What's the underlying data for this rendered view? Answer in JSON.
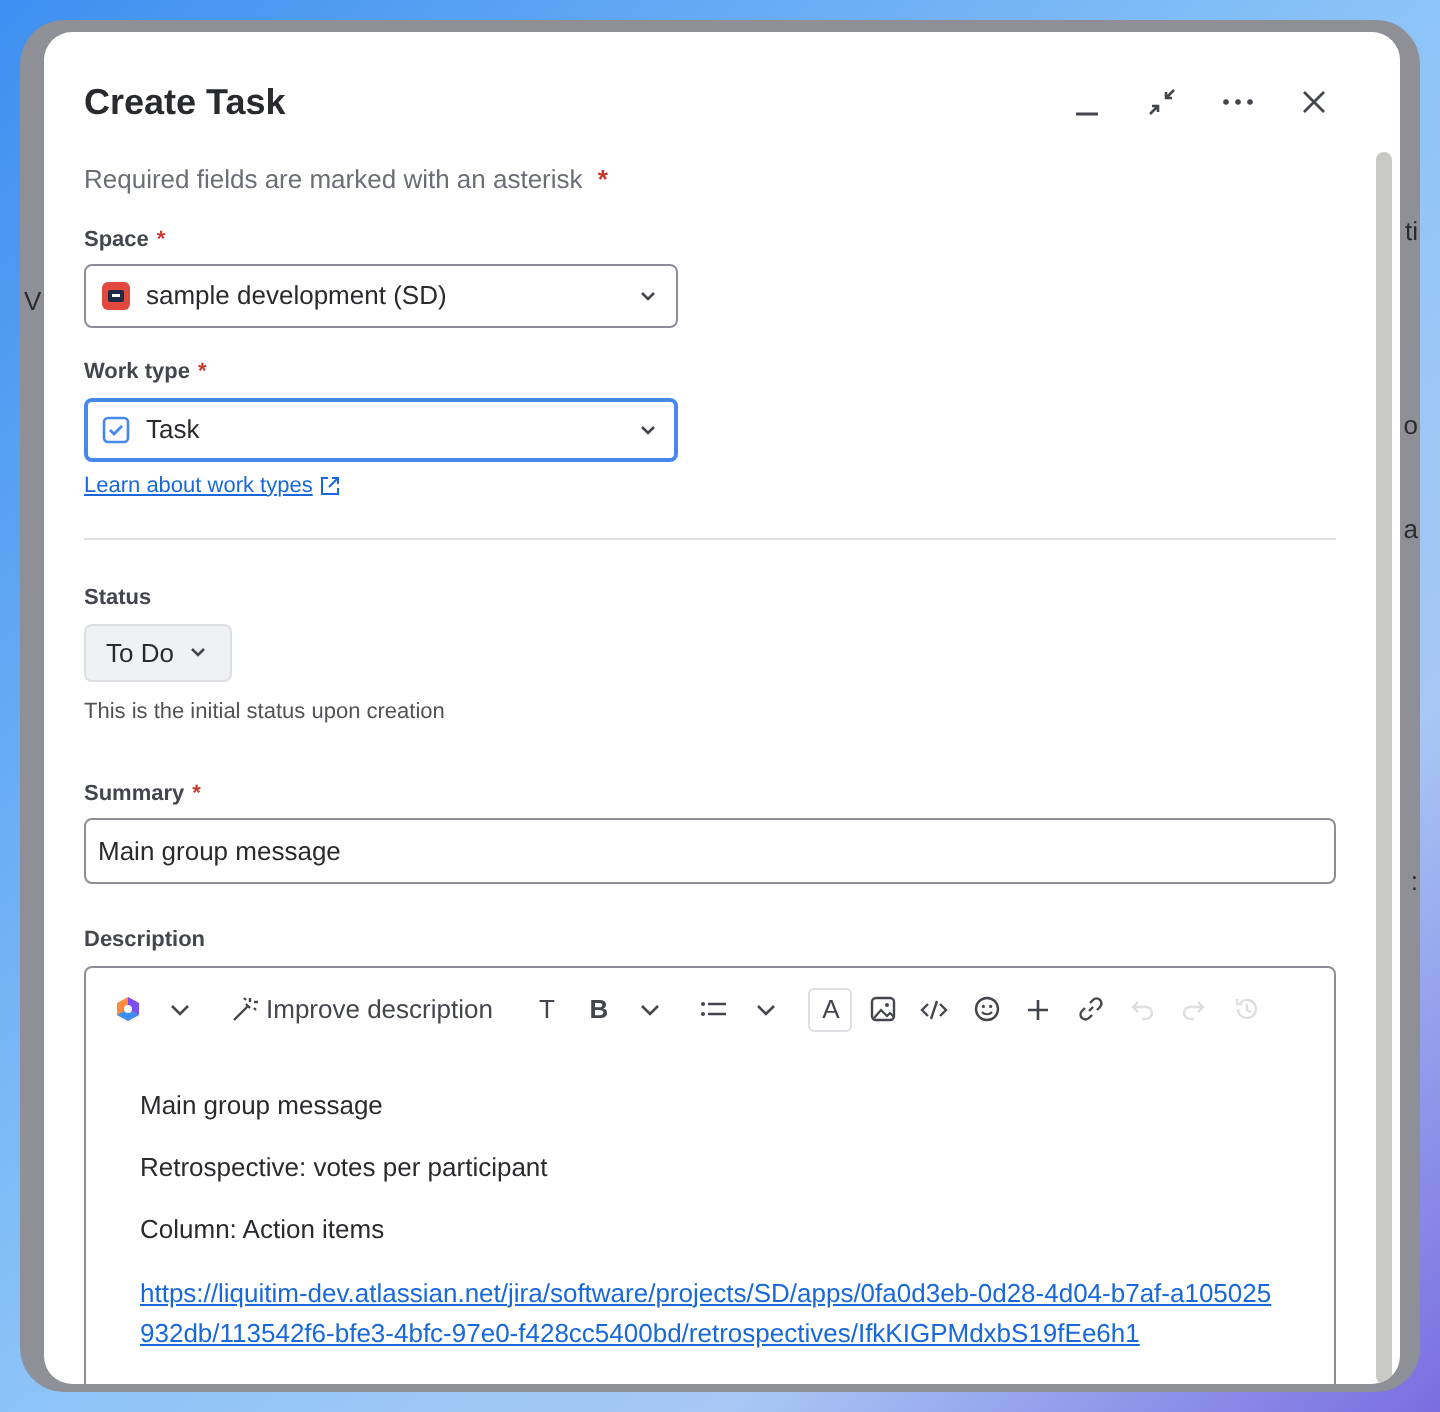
{
  "backdrop_fragments": [
    {
      "text": "V"
    },
    {
      "text": "ti"
    },
    {
      "text": "o"
    },
    {
      "text": "a"
    },
    {
      "text": ":"
    }
  ],
  "dialog": {
    "title": "Create Task",
    "actions": [
      {
        "kind": "minimize"
      },
      {
        "kind": "collapse"
      },
      {
        "kind": "more"
      },
      {
        "kind": "close"
      }
    ]
  },
  "required_note": {
    "text": "Required fields are marked with an asterisk",
    "marker": "*"
  },
  "space": {
    "label": "Space",
    "required": true,
    "value": "sample development (SD)",
    "focused": false
  },
  "work_type": {
    "label": "Work type",
    "required": true,
    "value": "Task",
    "focused": true,
    "link": "Learn about work types"
  },
  "status": {
    "label": "Status",
    "value": "To Do",
    "help": "This is the initial status upon creation"
  },
  "summary": {
    "label": "Summary",
    "required": true,
    "value": "Main group message"
  },
  "description": {
    "label": "Description",
    "toolbar": [
      {
        "kind": "ai-logo",
        "disabled": false,
        "selected": false
      },
      {
        "kind": "chevron",
        "disabled": false,
        "selected": false
      },
      {
        "kind": "improve",
        "label": "Improve description",
        "disabled": false,
        "selected": false
      },
      {
        "kind": "glyph",
        "label": "T",
        "disabled": false,
        "selected": false
      },
      {
        "kind": "glyph-bold",
        "label": "B",
        "disabled": false,
        "selected": false
      },
      {
        "kind": "chevron",
        "disabled": false,
        "selected": false
      },
      {
        "kind": "list",
        "disabled": false,
        "selected": false
      },
      {
        "kind": "chevron",
        "disabled": false,
        "selected": false
      },
      {
        "kind": "glyph",
        "label": "A",
        "disabled": false,
        "selected": true
      },
      {
        "kind": "image",
        "disabled": false,
        "selected": false
      },
      {
        "kind": "code",
        "disabled": false,
        "selected": false
      },
      {
        "kind": "emoji",
        "disabled": false,
        "selected": false
      },
      {
        "kind": "plus",
        "disabled": false,
        "selected": false
      },
      {
        "kind": "link",
        "disabled": false,
        "selected": false
      },
      {
        "kind": "undo",
        "disabled": true,
        "selected": false
      },
      {
        "kind": "redo",
        "disabled": true,
        "selected": false
      },
      {
        "kind": "history",
        "disabled": true,
        "selected": false
      }
    ],
    "content": [
      {
        "kind": "paragraph",
        "text": "Main group message"
      },
      {
        "kind": "paragraph",
        "text": "Retrospective: votes per participant"
      },
      {
        "kind": "paragraph",
        "text": "Column: Action items"
      },
      {
        "kind": "link",
        "text": "https://liquitim-dev.atlassian.net/jira/software/projects/SD/apps/0fa0d3eb-0d28-4d04-b7af-a105025932db/113542f6-bfe3-4bfc-97e0-f428cc5400bd/retrospectives/IfkKIGPMdxbS19fEe6h1"
      }
    ]
  }
}
